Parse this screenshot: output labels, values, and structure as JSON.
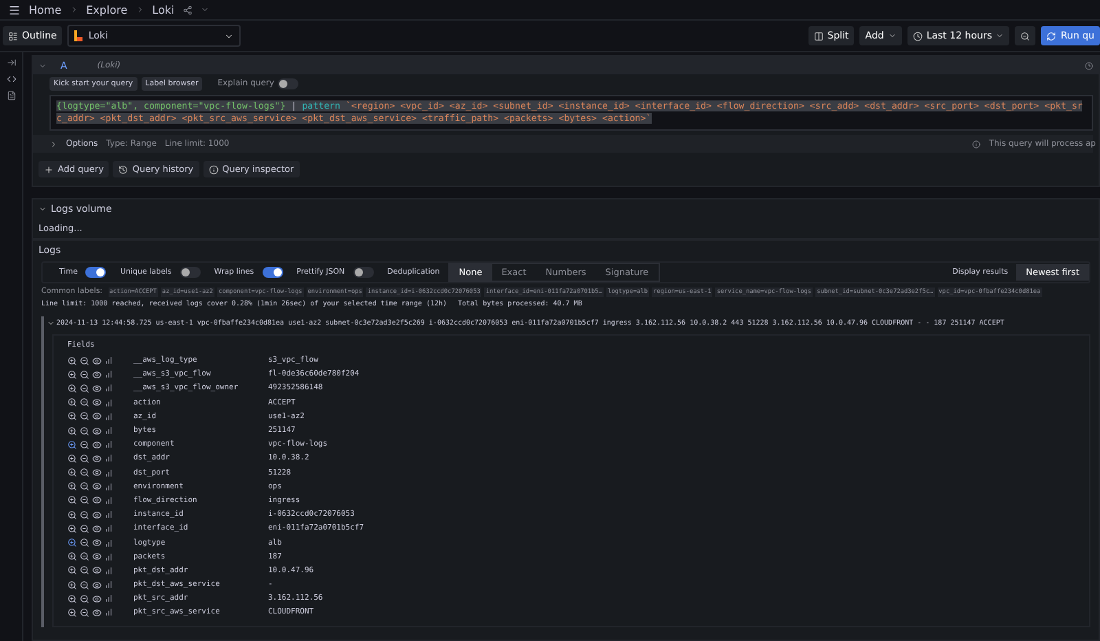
{
  "breadcrumbs": [
    "Home",
    "Explore",
    "Loki"
  ],
  "toolbar": {
    "outline": "Outline",
    "datasource": "Loki",
    "split": "Split",
    "add": "Add",
    "time_range": "Last 12 hours",
    "run": "Run qu"
  },
  "query": {
    "letter": "A",
    "datasource": "(Loki)",
    "kick_start": "Kick start your query",
    "label_browser": "Label browser",
    "explain": {
      "label": "Explain query",
      "checked": false
    },
    "selector": "{logtype=\"alb\", component=\"vpc-flow-logs\"}",
    "pipe": "|",
    "operator": "pattern",
    "pattern": "`<region> <vpc_id> <az_id> <subnet_id> <instance_id> <interface_id> <flow_direction> <src_add> <dst_addr> <src_port> <dst_port> <pkt_src_addr> <pkt_dst_addr> <pkt_src_aws_service> <pkt_dst_aws_service> <traffic_path> <packets> <bytes> <action>`",
    "options": "Options",
    "type": "Type: Range",
    "line_limit": "Line limit: 1000",
    "hint": "This query will process ap"
  },
  "actions": [
    "Add query",
    "Query history",
    "Query inspector"
  ],
  "logs_volume": {
    "title": "Logs volume",
    "status": "Loading..."
  },
  "logs": {
    "title": "Logs",
    "toggles": [
      {
        "label": "Time",
        "checked": true
      },
      {
        "label": "Unique labels",
        "checked": false
      },
      {
        "label": "Wrap lines",
        "checked": true
      },
      {
        "label": "Prettify JSON",
        "checked": false
      }
    ],
    "dedup_label": "Deduplication",
    "dedup": [
      {
        "label": "None",
        "selected": true
      },
      {
        "label": "Exact",
        "selected": false
      },
      {
        "label": "Numbers",
        "selected": false
      },
      {
        "label": "Signature",
        "selected": false
      }
    ],
    "display_label": "Display results",
    "order": "Newest first",
    "common_labels_title": "Common labels:",
    "common_labels": [
      "action=ACCEPT",
      "az_id=use1-az2",
      "component=vpc-flow-logs",
      "environment=ops",
      "instance_id=i-0632ccd0c72076053",
      "interface_id=eni-011fa72a0701b5…",
      "logtype=alb",
      "region=us-east-1",
      "service_name=vpc-flow-logs",
      "subnet_id=subnet-0c3e72ad3e2f5c…",
      "vpc_id=vpc-0fbaffe234c0d81ea"
    ],
    "limit_info": "Line limit: 1000 reached, received logs cover 0.28% (1min 26sec) of your selected time range (12h)",
    "bytes_info": "Total bytes processed: 40.7 MB",
    "line": {
      "expanded": true,
      "text": "2024-11-13 12:44:58.725 us-east-1 vpc-0fbaffe234c0d81ea use1-az2 subnet-0c3e72ad3e2f5c269 i-0632ccd0c72076053 eni-011fa72a0701b5cf7 ingress 3.162.112.56 10.0.38.2 443 51228 3.162.112.56 10.0.47.96 CLOUDFRONT - - 187 251147 ACCEPT"
    },
    "fields_title": "Fields",
    "fields": [
      {
        "name": "__aws_log_type",
        "value": "s3_vpc_flow",
        "filtered": false
      },
      {
        "name": "__aws_s3_vpc_flow",
        "value": "fl-0de36c60de780f204",
        "filtered": false
      },
      {
        "name": "__aws_s3_vpc_flow_owner",
        "value": "492352586148",
        "filtered": false
      },
      {
        "name": "action",
        "value": "ACCEPT",
        "filtered": false
      },
      {
        "name": "az_id",
        "value": "use1-az2",
        "filtered": false
      },
      {
        "name": "bytes",
        "value": "251147",
        "filtered": false
      },
      {
        "name": "component",
        "value": "vpc-flow-logs",
        "filtered": true
      },
      {
        "name": "dst_addr",
        "value": "10.0.38.2",
        "filtered": false
      },
      {
        "name": "dst_port",
        "value": "51228",
        "filtered": false
      },
      {
        "name": "environment",
        "value": "ops",
        "filtered": false
      },
      {
        "name": "flow_direction",
        "value": "ingress",
        "filtered": false
      },
      {
        "name": "instance_id",
        "value": "i-0632ccd0c72076053",
        "filtered": false
      },
      {
        "name": "interface_id",
        "value": "eni-011fa72a0701b5cf7",
        "filtered": false
      },
      {
        "name": "logtype",
        "value": "alb",
        "filtered": true
      },
      {
        "name": "packets",
        "value": "187",
        "filtered": false
      },
      {
        "name": "pkt_dst_addr",
        "value": "10.0.47.96",
        "filtered": false
      },
      {
        "name": "pkt_dst_aws_service",
        "value": "-",
        "filtered": false
      },
      {
        "name": "pkt_src_addr",
        "value": "3.162.112.56",
        "filtered": false
      },
      {
        "name": "pkt_src_aws_service",
        "value": "CLOUDFRONT",
        "filtered": false
      }
    ]
  }
}
